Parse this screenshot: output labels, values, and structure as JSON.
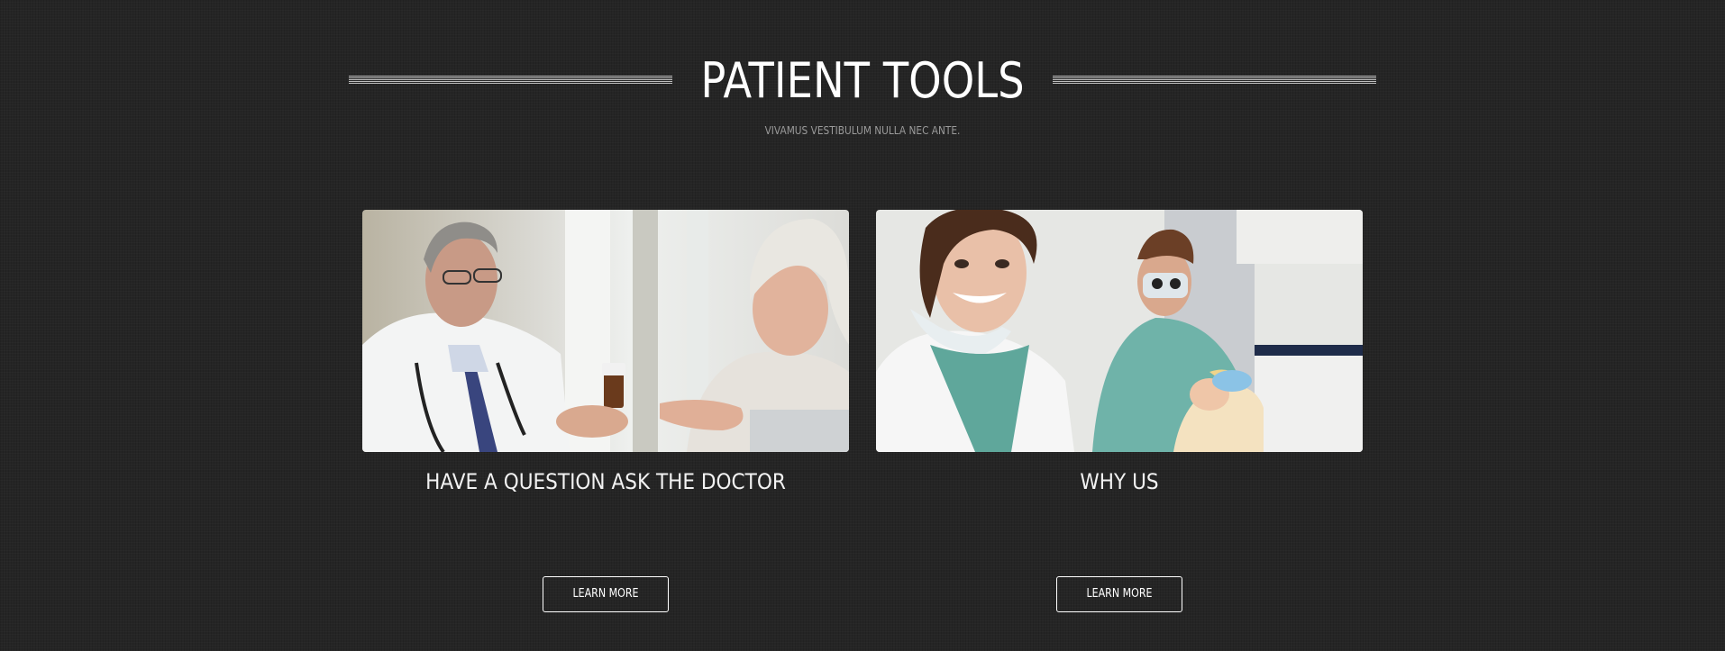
{
  "header": {
    "title": "PATIENT TOOLS",
    "subtitle": "VIVAMUS VESTIBULUM NULLA NEC ANTE."
  },
  "cards": [
    {
      "title": "HAVE A QUESTION ASK THE DOCTOR",
      "button_label": "LEARN MORE",
      "image": "photo-doctor-consulting-elderly-patient"
    },
    {
      "title": "WHY US",
      "button_label": "LEARN MORE",
      "image": "photo-dental-assistant-smiling"
    }
  ],
  "colors": {
    "background": "#252525",
    "text": "#ffffff",
    "subtitle": "#9a9a9a"
  }
}
